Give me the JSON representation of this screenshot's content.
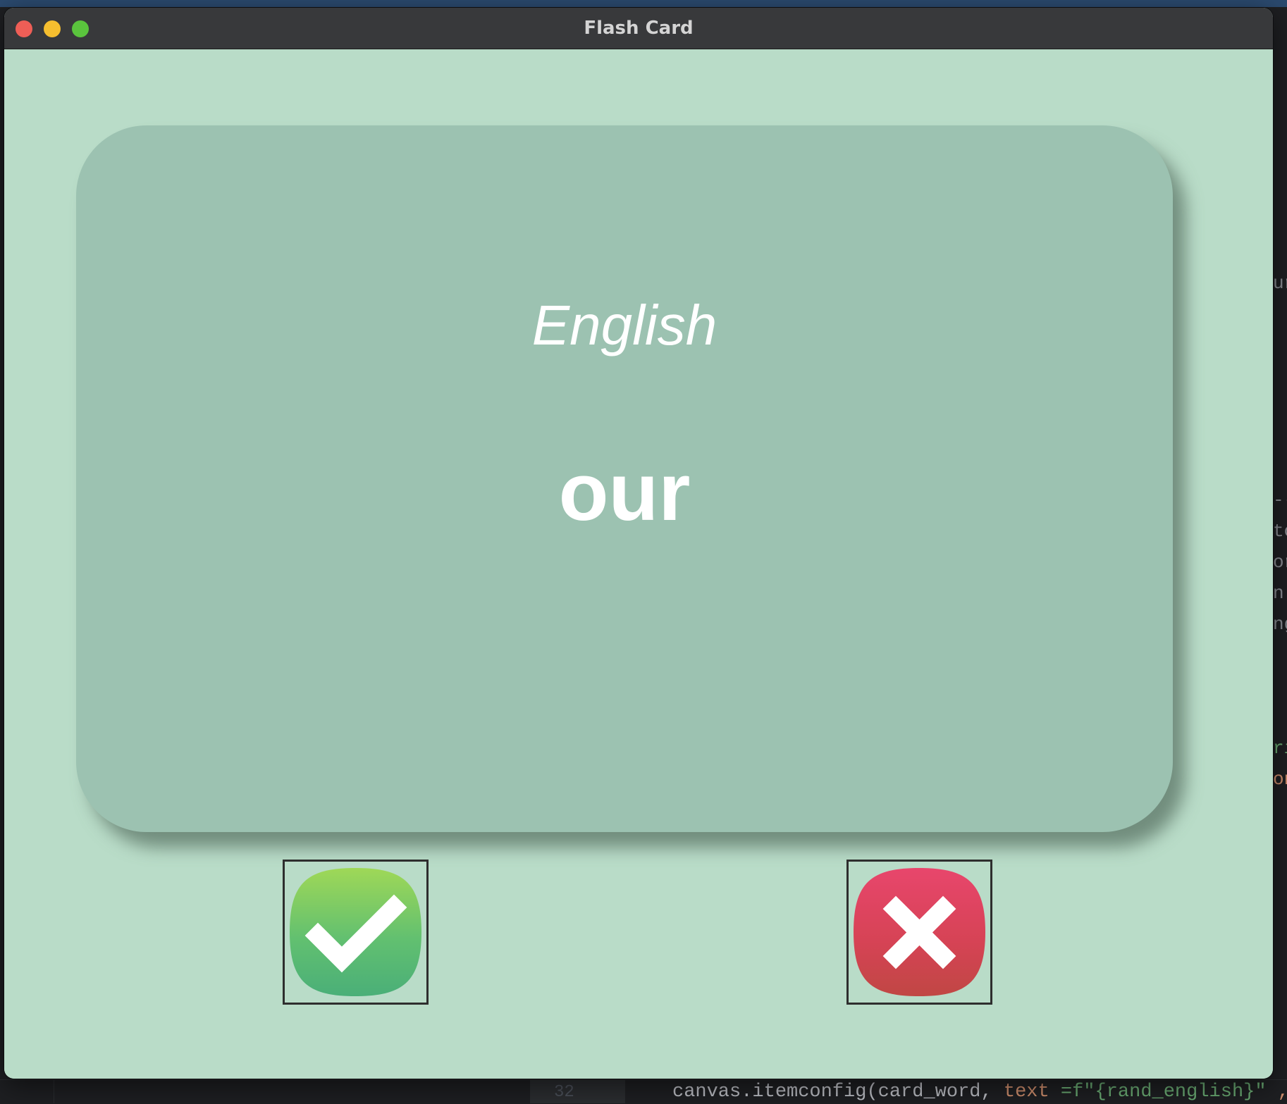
{
  "window": {
    "title": "Flash Card"
  },
  "card": {
    "title": "English",
    "word": "our",
    "colors": {
      "background": "#b9dcc8",
      "card": "#9cc2b1",
      "text": "#ffffff"
    }
  },
  "buttons": {
    "right": {
      "icon": "checkmark-icon",
      "color": "#5cc160"
    },
    "wrong": {
      "icon": "x-icon",
      "color": "#e0455f"
    }
  },
  "editor": {
    "line_number": "32",
    "code_prefix": "canvas.itemconfig(card_word, ",
    "code_kw": "text",
    "code_mid": " =f\"{rand_english}\"",
    "code_suffix": " ,fo",
    "edge_fragments": [
      "ur",
      "--",
      "to",
      "or",
      "n",
      "ng",
      "",
      "",
      "",
      "",
      "",
      "ri",
      "on",
      "",
      "",
      "",
      "\""
    ]
  }
}
